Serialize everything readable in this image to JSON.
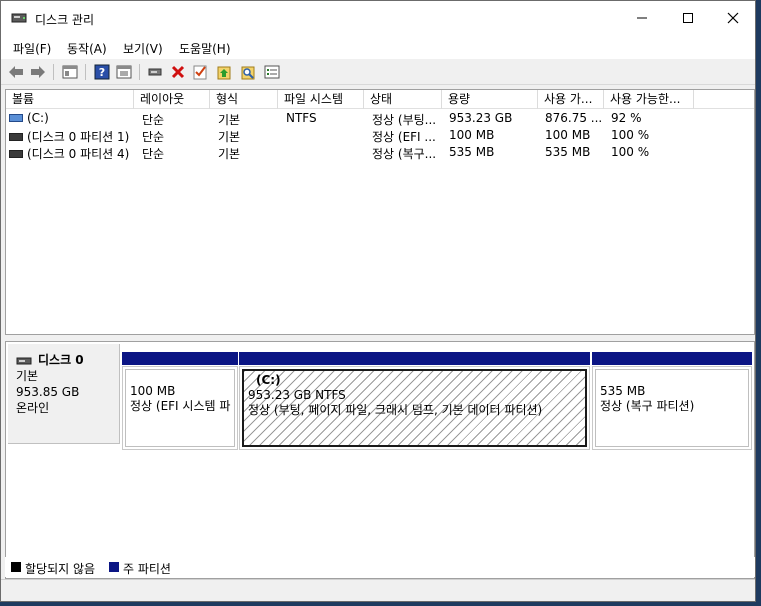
{
  "window": {
    "title": "디스크 관리",
    "controls": {
      "minimize": "—",
      "maximize": "☐",
      "close": "✕"
    }
  },
  "menu": [
    "파일(F)",
    "동작(A)",
    "보기(V)",
    "도움말(H)"
  ],
  "toolbar": [
    "back-icon",
    "forward-icon",
    "show-hide-console-tree-icon",
    "help-icon",
    "properties-icon",
    "connect-icon",
    "delete-icon",
    "check-icon",
    "up-icon",
    "search-icon",
    "settings-list-icon"
  ],
  "volume_list": {
    "columns": [
      "볼륨",
      "레이아웃",
      "형식",
      "파일 시스템",
      "상태",
      "용량",
      "사용 가...",
      "사용 가능한..."
    ],
    "rows": [
      {
        "volume": "(C:)",
        "layout": "단순",
        "type": "기본",
        "fs": "NTFS",
        "status": "정상 (부팅...",
        "capacity": "953.23 GB",
        "free": "876.75 ...",
        "pct": "92 %"
      },
      {
        "volume": "(디스크 0 파티션 1)",
        "layout": "단순",
        "type": "기본",
        "fs": "",
        "status": "정상 (EFI ...",
        "capacity": "100 MB",
        "free": "100 MB",
        "pct": "100 %"
      },
      {
        "volume": "(디스크 0 파티션 4)",
        "layout": "단순",
        "type": "기본",
        "fs": "",
        "status": "정상 (복구...",
        "capacity": "535 MB",
        "free": "535 MB",
        "pct": "100 %"
      }
    ]
  },
  "disk": {
    "name": "디스크 0",
    "type": "기본",
    "size": "953.85 GB",
    "state": "온라인",
    "partitions": [
      {
        "label": "",
        "size": "100 MB",
        "status": "정상 (EFI 시스템 파",
        "hatched": false
      },
      {
        "label": "(C:)",
        "size": "953.23 GB NTFS",
        "status": "정상 (부팅, 페이지 파일, 크래시 덤프, 기본 데이터 파티션)",
        "hatched": true
      },
      {
        "label": "",
        "size": "535 MB",
        "status": "정상 (복구 파티션)",
        "hatched": false
      }
    ]
  },
  "legend": [
    {
      "label": "할당되지 않음",
      "color": "#000000"
    },
    {
      "label": "주 파티션",
      "color": "#0b1584"
    }
  ]
}
